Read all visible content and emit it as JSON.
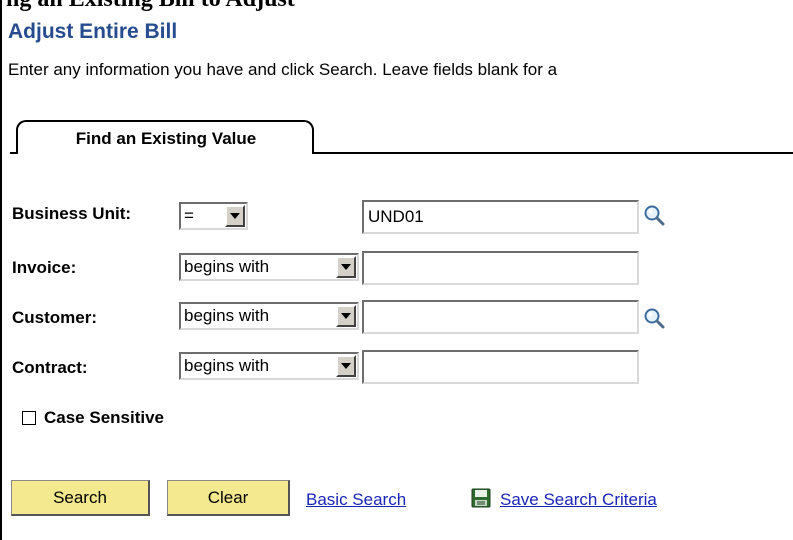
{
  "header": {
    "cut_text": "ng an Existing Bill to Adjust",
    "title": "Adjust Entire Bill",
    "instructions": "Enter any information you have and click Search. Leave fields blank for a"
  },
  "tab": {
    "label": "Find an Existing Value"
  },
  "form": {
    "business_unit": {
      "label": "Business Unit:",
      "operator": "=",
      "value": "UND01"
    },
    "invoice": {
      "label": "Invoice:",
      "operator": "begins with",
      "value": ""
    },
    "customer": {
      "label": "Customer:",
      "operator": "begins with",
      "value": ""
    },
    "contract": {
      "label": "Contract:",
      "operator": "begins with",
      "value": ""
    },
    "case_sensitive": {
      "label": "Case Sensitive",
      "checked": false
    }
  },
  "actions": {
    "search_label": "Search",
    "clear_label": "Clear",
    "basic_search_label": "Basic Search",
    "save_criteria_label": "Save Search Criteria"
  },
  "icons": {
    "lookup": "magnifier-lookup-icon",
    "save": "floppy-disk-icon"
  },
  "colors": {
    "title": "#264c8f",
    "button_bg": "#f4e98e",
    "link": "#1a25b8"
  }
}
